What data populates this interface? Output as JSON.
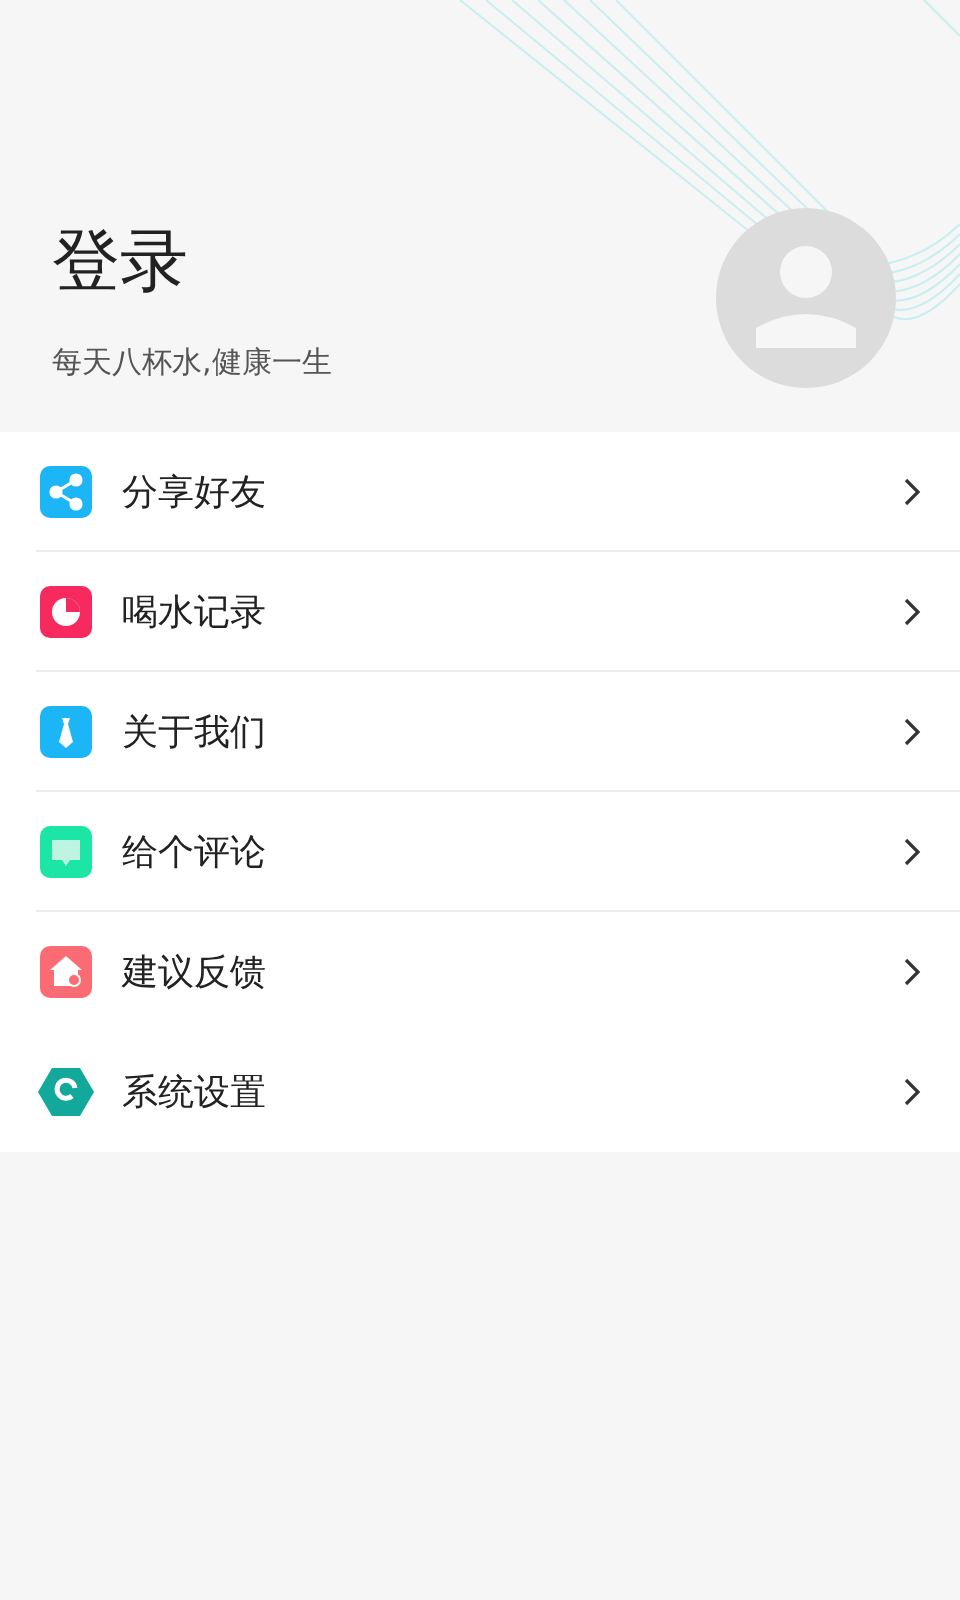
{
  "header": {
    "title": "登录",
    "subtitle": "每天八杯水,健康一生"
  },
  "menu": [
    {
      "label": "分享好友",
      "kind": "share",
      "color": "#1cb5f5",
      "divider": true
    },
    {
      "label": "喝水记录",
      "kind": "chart",
      "color": "#f62a5e",
      "divider": true
    },
    {
      "label": "关于我们",
      "kind": "tie",
      "color": "#1cb5f5",
      "divider": true
    },
    {
      "label": "给个评论",
      "kind": "chat",
      "color": "#1be6a6",
      "divider": true
    },
    {
      "label": "建议反馈",
      "kind": "house",
      "color": "#fb6b73",
      "divider": false
    },
    {
      "label": "系统设置",
      "kind": "hexagon",
      "color": "#12a99a",
      "divider": false
    }
  ]
}
